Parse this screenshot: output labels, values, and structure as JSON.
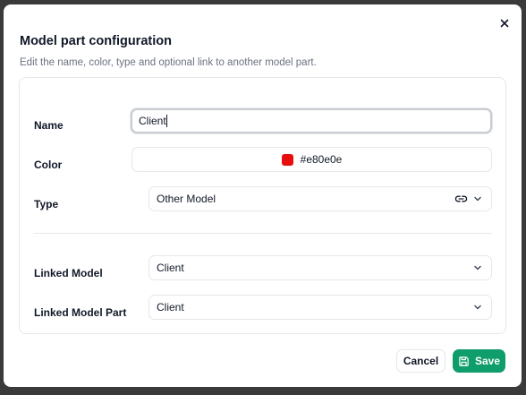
{
  "dialog": {
    "title": "Model part configuration",
    "subtitle": "Edit the name, color, type and optional link to another model part."
  },
  "form": {
    "name_label": "Name",
    "name_value": "Client",
    "color_label": "Color",
    "color_value": "#e80e0e",
    "type_label": "Type",
    "type_value": "Other Model",
    "linked_model_label": "Linked Model",
    "linked_model_value": "Client",
    "linked_model_part_label": "Linked Model Part",
    "linked_model_part_value": "Client"
  },
  "buttons": {
    "cancel_label": "Cancel",
    "save_label": "Save"
  },
  "colors": {
    "accent": "#0f9d6b",
    "swatch": "#e80e0e"
  },
  "icons": {
    "close": "close-icon",
    "link": "link-icon",
    "chevron": "chevron-down-icon",
    "save": "floppy-disk-icon"
  }
}
